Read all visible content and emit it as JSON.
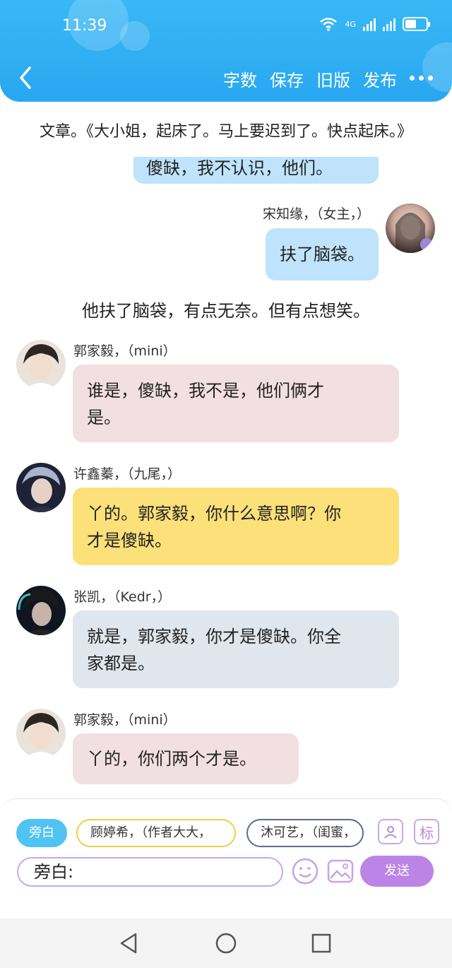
{
  "status_bar": {
    "time": "11:39",
    "network": "4G"
  },
  "header": {
    "actions": [
      "字数",
      "保存",
      "旧版",
      "发布"
    ],
    "bg_color": "#2ab0f3"
  },
  "article_line": "文章。《大小姐，起床了。马上要迟到了。快点起床。》",
  "chat": {
    "partial_top_text": "傻缺，我不认识，他们。",
    "right_message": {
      "name": "宋知缘，（女主，）",
      "text": "扶了脑袋。"
    },
    "narration": "他扶了脑袋，有点无奈。但有点想笑。",
    "messages": [
      {
        "name": "郭家毅，（mini）",
        "line1": "谁是，傻缺，我不是，他们俩才",
        "line2": "是。",
        "color": "#f2dfe1"
      },
      {
        "name": "许鑫蓁，（九尾，）",
        "line1": "丫的。郭家毅，你什么意思啊？你",
        "line2": "才是傻缺。",
        "color": "#fce07a"
      },
      {
        "name": "张凯，（Kedr，）",
        "line1": "就是，郭家毅，你才是傻缺。你全",
        "line2": "家都是。",
        "color": "#e0e6ee"
      },
      {
        "name": "郭家毅，（mini）",
        "line1": "丫的，你们两个才是。",
        "color": "#f2dfe1"
      }
    ]
  },
  "composer": {
    "chips": [
      "旁白",
      "顾婷希，（作者大大，",
      "沐可艺，（闺蜜，"
    ],
    "tag_label": "标",
    "input_value": "旁白:",
    "send_label": "发送"
  }
}
